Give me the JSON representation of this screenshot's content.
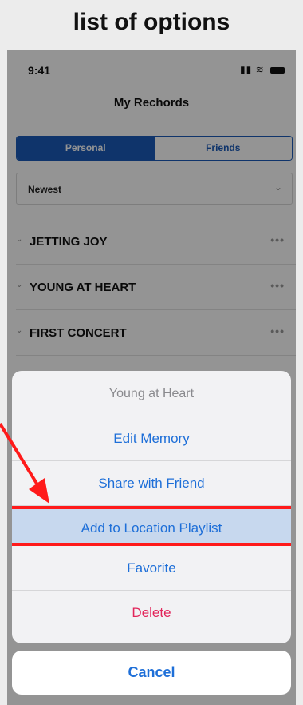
{
  "caption": "list of options",
  "status_bar": {
    "time": "9:41"
  },
  "nav": {
    "title": "My Rechords"
  },
  "segmented": {
    "personal": "Personal",
    "friends": "Friends"
  },
  "sort": {
    "selected": "Newest"
  },
  "list_items": [
    {
      "title": "JETTING JOY"
    },
    {
      "title": "YOUNG AT HEART"
    },
    {
      "title": "FIRST CONCERT"
    }
  ],
  "action_sheet": {
    "title": "Young at Heart",
    "actions": [
      "Edit Memory",
      "Share with Friend",
      "Add to Location Playlist",
      "Favorite",
      "Delete"
    ],
    "cancel": "Cancel"
  },
  "colors": {
    "accent": "#1a5bb8",
    "link": "#1e6fd8",
    "destructive": "#e2255a",
    "highlight_border": "#ff1a1a"
  }
}
